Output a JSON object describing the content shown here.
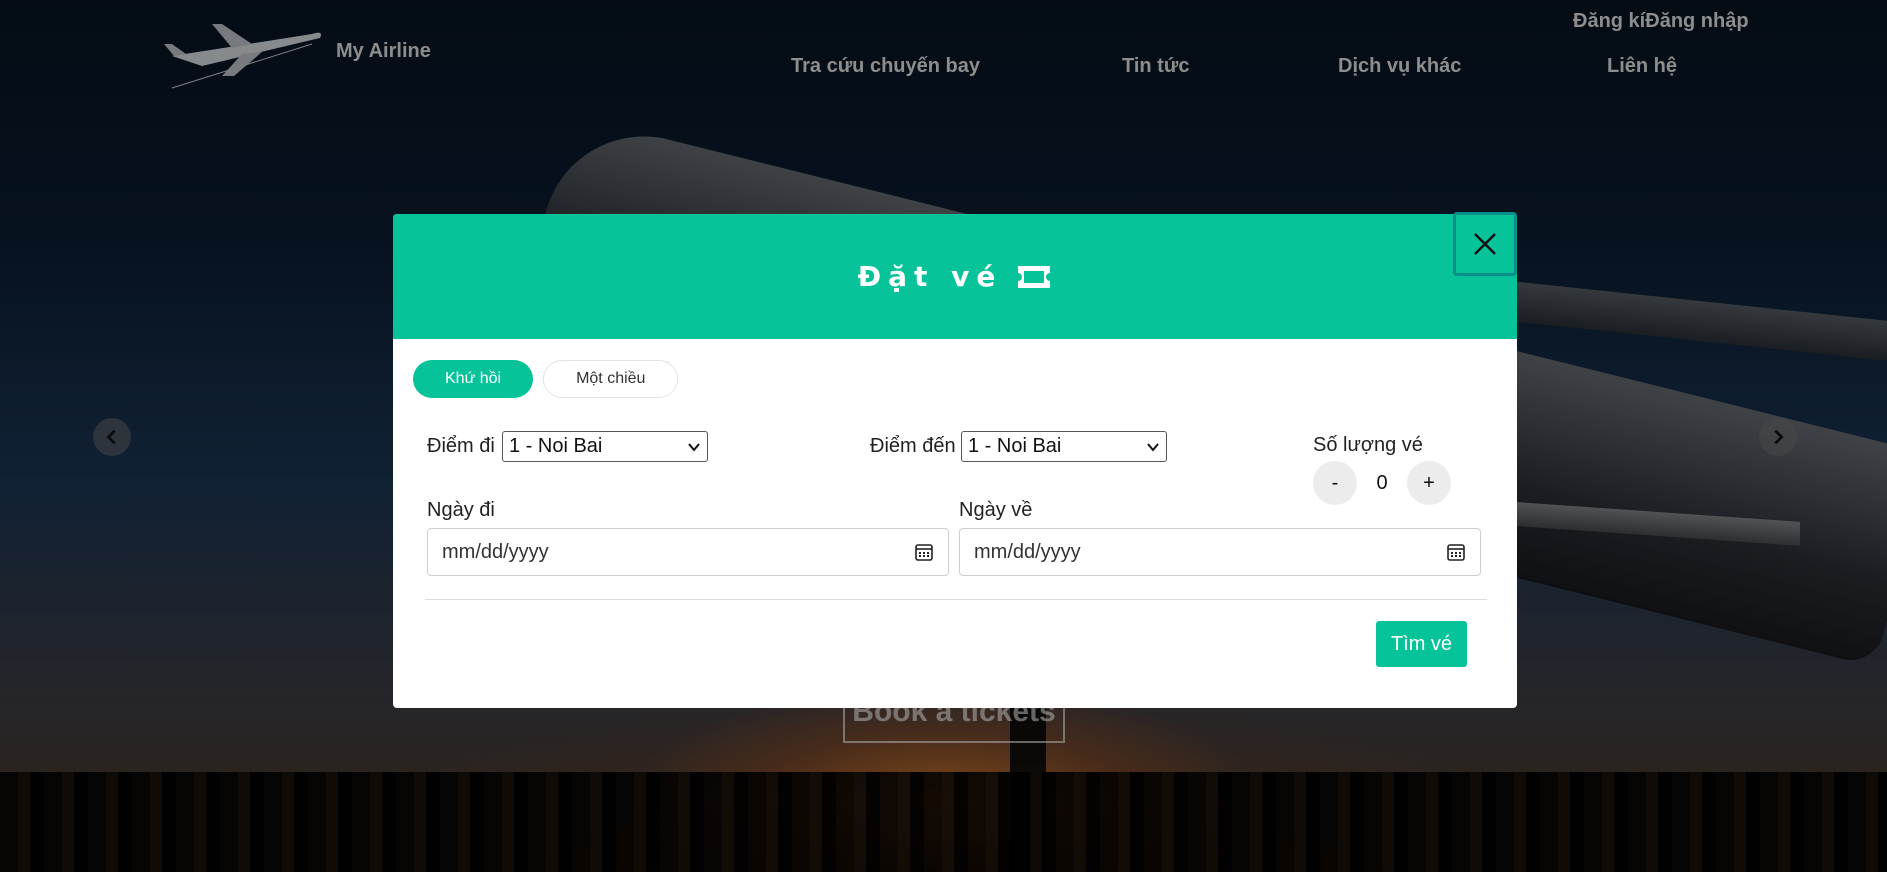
{
  "header": {
    "brand": "My Airline",
    "auth_register": "Đăng kí",
    "auth_login": "Đăng nhập",
    "nav": [
      "Tra cứu chuyến bay",
      "Tin tức",
      "Dịch vụ khác",
      "Liên hệ"
    ]
  },
  "hero": {
    "cta_label": "Book a tickets"
  },
  "modal": {
    "title": "Đặt vé",
    "title_icon": "ticket-icon",
    "close_icon": "close-icon",
    "trip_types": {
      "round_trip": "Khứ hồi",
      "one_way": "Một chiều",
      "selected": "Khứ hồi"
    },
    "from": {
      "label": "Điểm đi",
      "value": "1 - Noi Bai"
    },
    "to": {
      "label": "Điểm đến",
      "value": "1 - Noi Bai"
    },
    "quantity": {
      "label": "Số lượng vé",
      "minus": "-",
      "value": "0",
      "plus": "+"
    },
    "depart_date": {
      "label": "Ngày đi",
      "placeholder": "mm/dd/yyyy"
    },
    "return_date": {
      "label": "Ngày về",
      "placeholder": "mm/dd/yyyy"
    },
    "search_button": "Tìm vé"
  },
  "colors": {
    "accent": "#06c39a",
    "close_border": "#0a8f8a"
  }
}
